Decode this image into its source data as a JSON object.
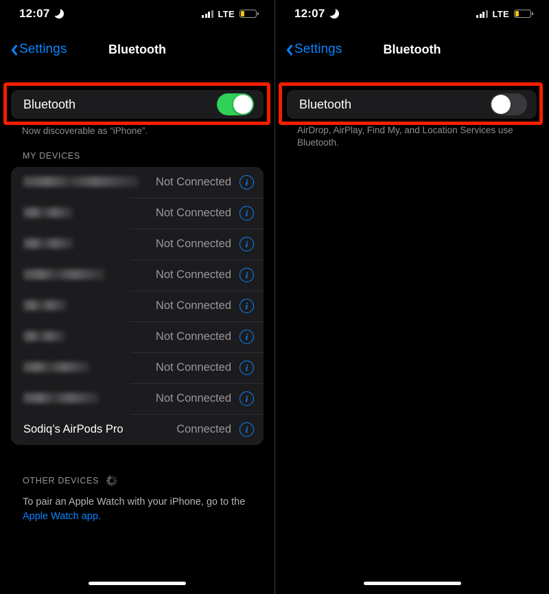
{
  "panels": [
    {
      "status_bar": {
        "time": "12:07",
        "moon_icon": "crescent-moon-icon",
        "signal_icon": "cellular-bars-icon",
        "network": "LTE",
        "battery_icon": "battery-low-power-icon"
      },
      "nav": {
        "back_label": "Settings",
        "back_icon": "chevron-left-icon",
        "title": "Bluetooth"
      },
      "bluetooth": {
        "label": "Bluetooth",
        "state": "on",
        "footnote": "Now discoverable as “iPhone”."
      },
      "my_devices": {
        "header": "MY DEVICES",
        "rows": [
          {
            "name": "",
            "redacted": true,
            "redacted_width": 168,
            "status": "Not Connected",
            "info_icon": "info-circle-icon"
          },
          {
            "name": "",
            "redacted": true,
            "redacted_width": 72,
            "status": "Not Connected",
            "info_icon": "info-circle-icon"
          },
          {
            "name": "",
            "redacted": true,
            "redacted_width": 73,
            "status": "Not Connected",
            "info_icon": "info-circle-icon"
          },
          {
            "name": "",
            "redacted": true,
            "redacted_width": 119,
            "status": "Not Connected",
            "info_icon": "info-circle-icon"
          },
          {
            "name": "",
            "redacted": true,
            "redacted_width": 63,
            "status": "Not Connected",
            "info_icon": "info-circle-icon"
          },
          {
            "name": "",
            "redacted": true,
            "redacted_width": 60,
            "status": "Not Connected",
            "info_icon": "info-circle-icon"
          },
          {
            "name": "",
            "redacted": true,
            "redacted_width": 96,
            "status": "Not Connected",
            "info_icon": "info-circle-icon"
          },
          {
            "name": "",
            "redacted": true,
            "redacted_width": 110,
            "status": "Not Connected",
            "info_icon": "info-circle-icon"
          },
          {
            "name": "Sodiq’s AirPods Pro",
            "redacted": false,
            "redacted_width": 0,
            "status": "Connected",
            "info_icon": "info-circle-icon"
          }
        ]
      },
      "other_devices": {
        "header": "OTHER DEVICES",
        "spinner_icon": "activity-spinner-icon",
        "note_text": "To pair an Apple Watch with your iPhone, go to the ",
        "note_link": "Apple Watch app."
      }
    },
    {
      "status_bar": {
        "time": "12:07",
        "moon_icon": "crescent-moon-icon",
        "signal_icon": "cellular-bars-icon",
        "network": "LTE",
        "battery_icon": "battery-low-power-icon"
      },
      "nav": {
        "back_label": "Settings",
        "back_icon": "chevron-left-icon",
        "title": "Bluetooth"
      },
      "bluetooth": {
        "label": "Bluetooth",
        "state": "off",
        "footnote": "AirDrop, AirPlay, Find My, and Location Services use Bluetooth."
      }
    }
  ],
  "colors": {
    "accent_blue": "#0a84ff",
    "toggle_on_green": "#30d158",
    "toggle_off_gray": "#3a3a3c",
    "highlight_red": "#f61e00",
    "battery_yellow": "#f5c518",
    "card_background": "#1c1c1e"
  }
}
